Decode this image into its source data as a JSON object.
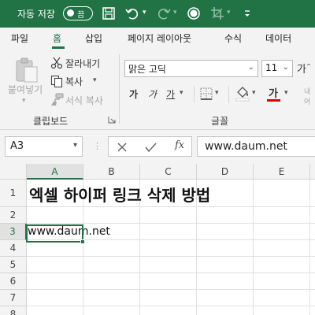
{
  "titlebar": {
    "autosave_label": "자동 저장",
    "autosave_state": "끔"
  },
  "tabs": [
    {
      "label": "파일"
    },
    {
      "label": "홈"
    },
    {
      "label": "삽입"
    },
    {
      "label": "페이지 레이아웃"
    },
    {
      "label": "수식"
    },
    {
      "label": "데이터"
    }
  ],
  "ribbon": {
    "paste_label": "붙여넣기",
    "cut_label": "잘라내기",
    "copy_label": "복사",
    "format_painter_label": "서식 복사",
    "clipboard_group": "클립보드",
    "font_name": "맑은 고딕",
    "font_size": "11",
    "bold": "가",
    "italic": "가",
    "underline": "가",
    "font_color_glyph": "가",
    "font_group": "글꼴",
    "grow_font": "가",
    "wrap_partial": "내어"
  },
  "formula_bar": {
    "name_box": "A3",
    "fx": "fx",
    "value": "www.daum.net"
  },
  "sheet": {
    "columns": [
      "A",
      "B",
      "C",
      "D",
      "E"
    ],
    "rows": [
      "1",
      "2",
      "3",
      "4",
      "5",
      "6",
      "7",
      "8",
      "9"
    ],
    "a1": "엑셀 하이퍼 링크 삭제 방법",
    "a3": "www.daum.net"
  },
  "colors": {
    "accent": "#217346",
    "font_color_bar": "#e00000"
  }
}
